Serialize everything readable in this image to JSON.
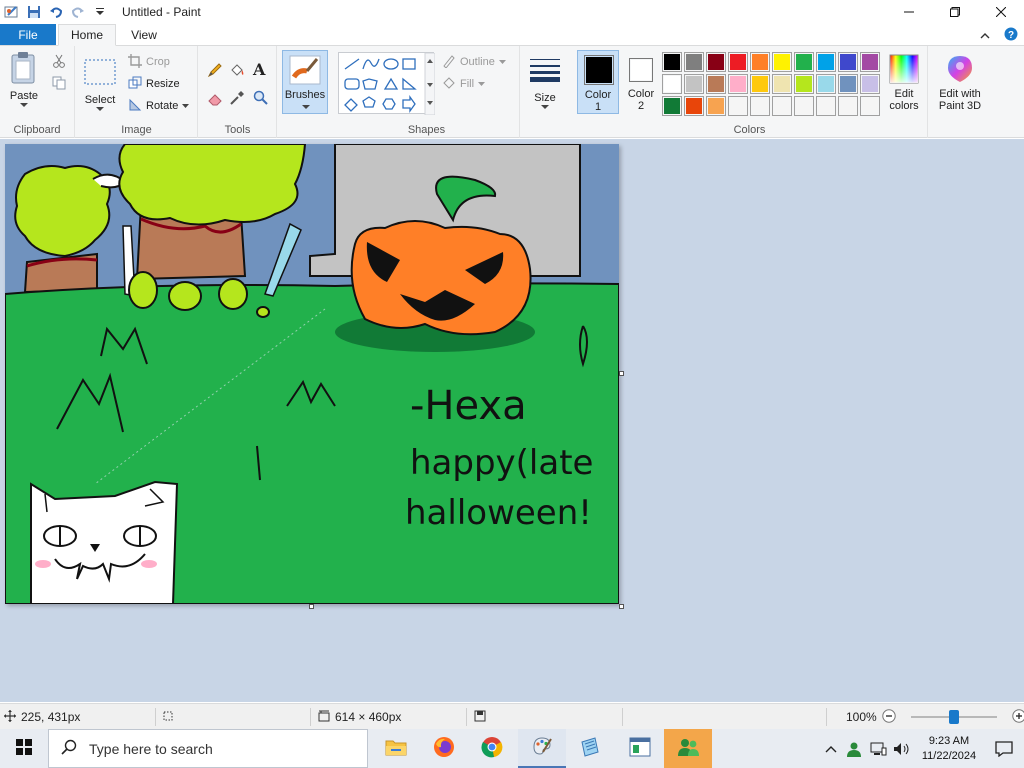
{
  "window": {
    "title": "Untitled - Paint"
  },
  "tabs": [
    {
      "label": "File"
    },
    {
      "label": "Home"
    },
    {
      "label": "View"
    }
  ],
  "ribbon": {
    "clipboard": {
      "label": "Clipboard",
      "paste": "Paste"
    },
    "image": {
      "label": "Image",
      "select": "Select",
      "crop": "Crop",
      "resize": "Resize",
      "rotate": "Rotate"
    },
    "tools": {
      "label": "Tools"
    },
    "brushes": {
      "label": "Brushes"
    },
    "shapes": {
      "label": "Shapes",
      "outline": "Outline",
      "fill": "Fill"
    },
    "size": {
      "label": "Size"
    },
    "colors": {
      "label": "Colors",
      "color1": "Color\n1",
      "color1_line1": "Color",
      "color1_line2": "1",
      "color2_line1": "Color",
      "color2_line2": "2",
      "edit_colors_line1": "Edit",
      "edit_colors_line2": "colors",
      "paint3d_line1": "Edit with",
      "paint3d_line2": "Paint 3D",
      "color1_value": "#000000",
      "color2_value": "#ffffff",
      "palette_row1": [
        "#000000",
        "#7f7f7f",
        "#880015",
        "#ed1c24",
        "#ff7f27",
        "#fff200",
        "#22b14c",
        "#00a2e8",
        "#3f48cc",
        "#a349a4"
      ],
      "palette_row2": [
        "#ffffff",
        "#c3c3c3",
        "#b97a57",
        "#ffaec9",
        "#ffc90e",
        "#efe4b0",
        "#b5e61d",
        "#99d9ea",
        "#7092be",
        "#c8bfe7"
      ],
      "palette_row3": [
        "#117a36",
        "#e8450a",
        "#f7a350",
        "#f5f5f5",
        "#f5f5f5",
        "#f5f5f5",
        "#f5f5f5",
        "#f5f5f5",
        "#f5f5f5",
        "#f5f5f5"
      ]
    }
  },
  "canvas": {
    "text_signature": "-Hexa",
    "text_line1": "happy(late",
    "text_line2": "halloween!",
    "letters_m": "M"
  },
  "status": {
    "cursor_pos": "225, 431px",
    "canvas_size": "614 × 460px",
    "zoom": "100%"
  },
  "taskbar": {
    "search_placeholder": "Type here to search",
    "time": "9:23 AM",
    "date": "11/22/2024"
  }
}
